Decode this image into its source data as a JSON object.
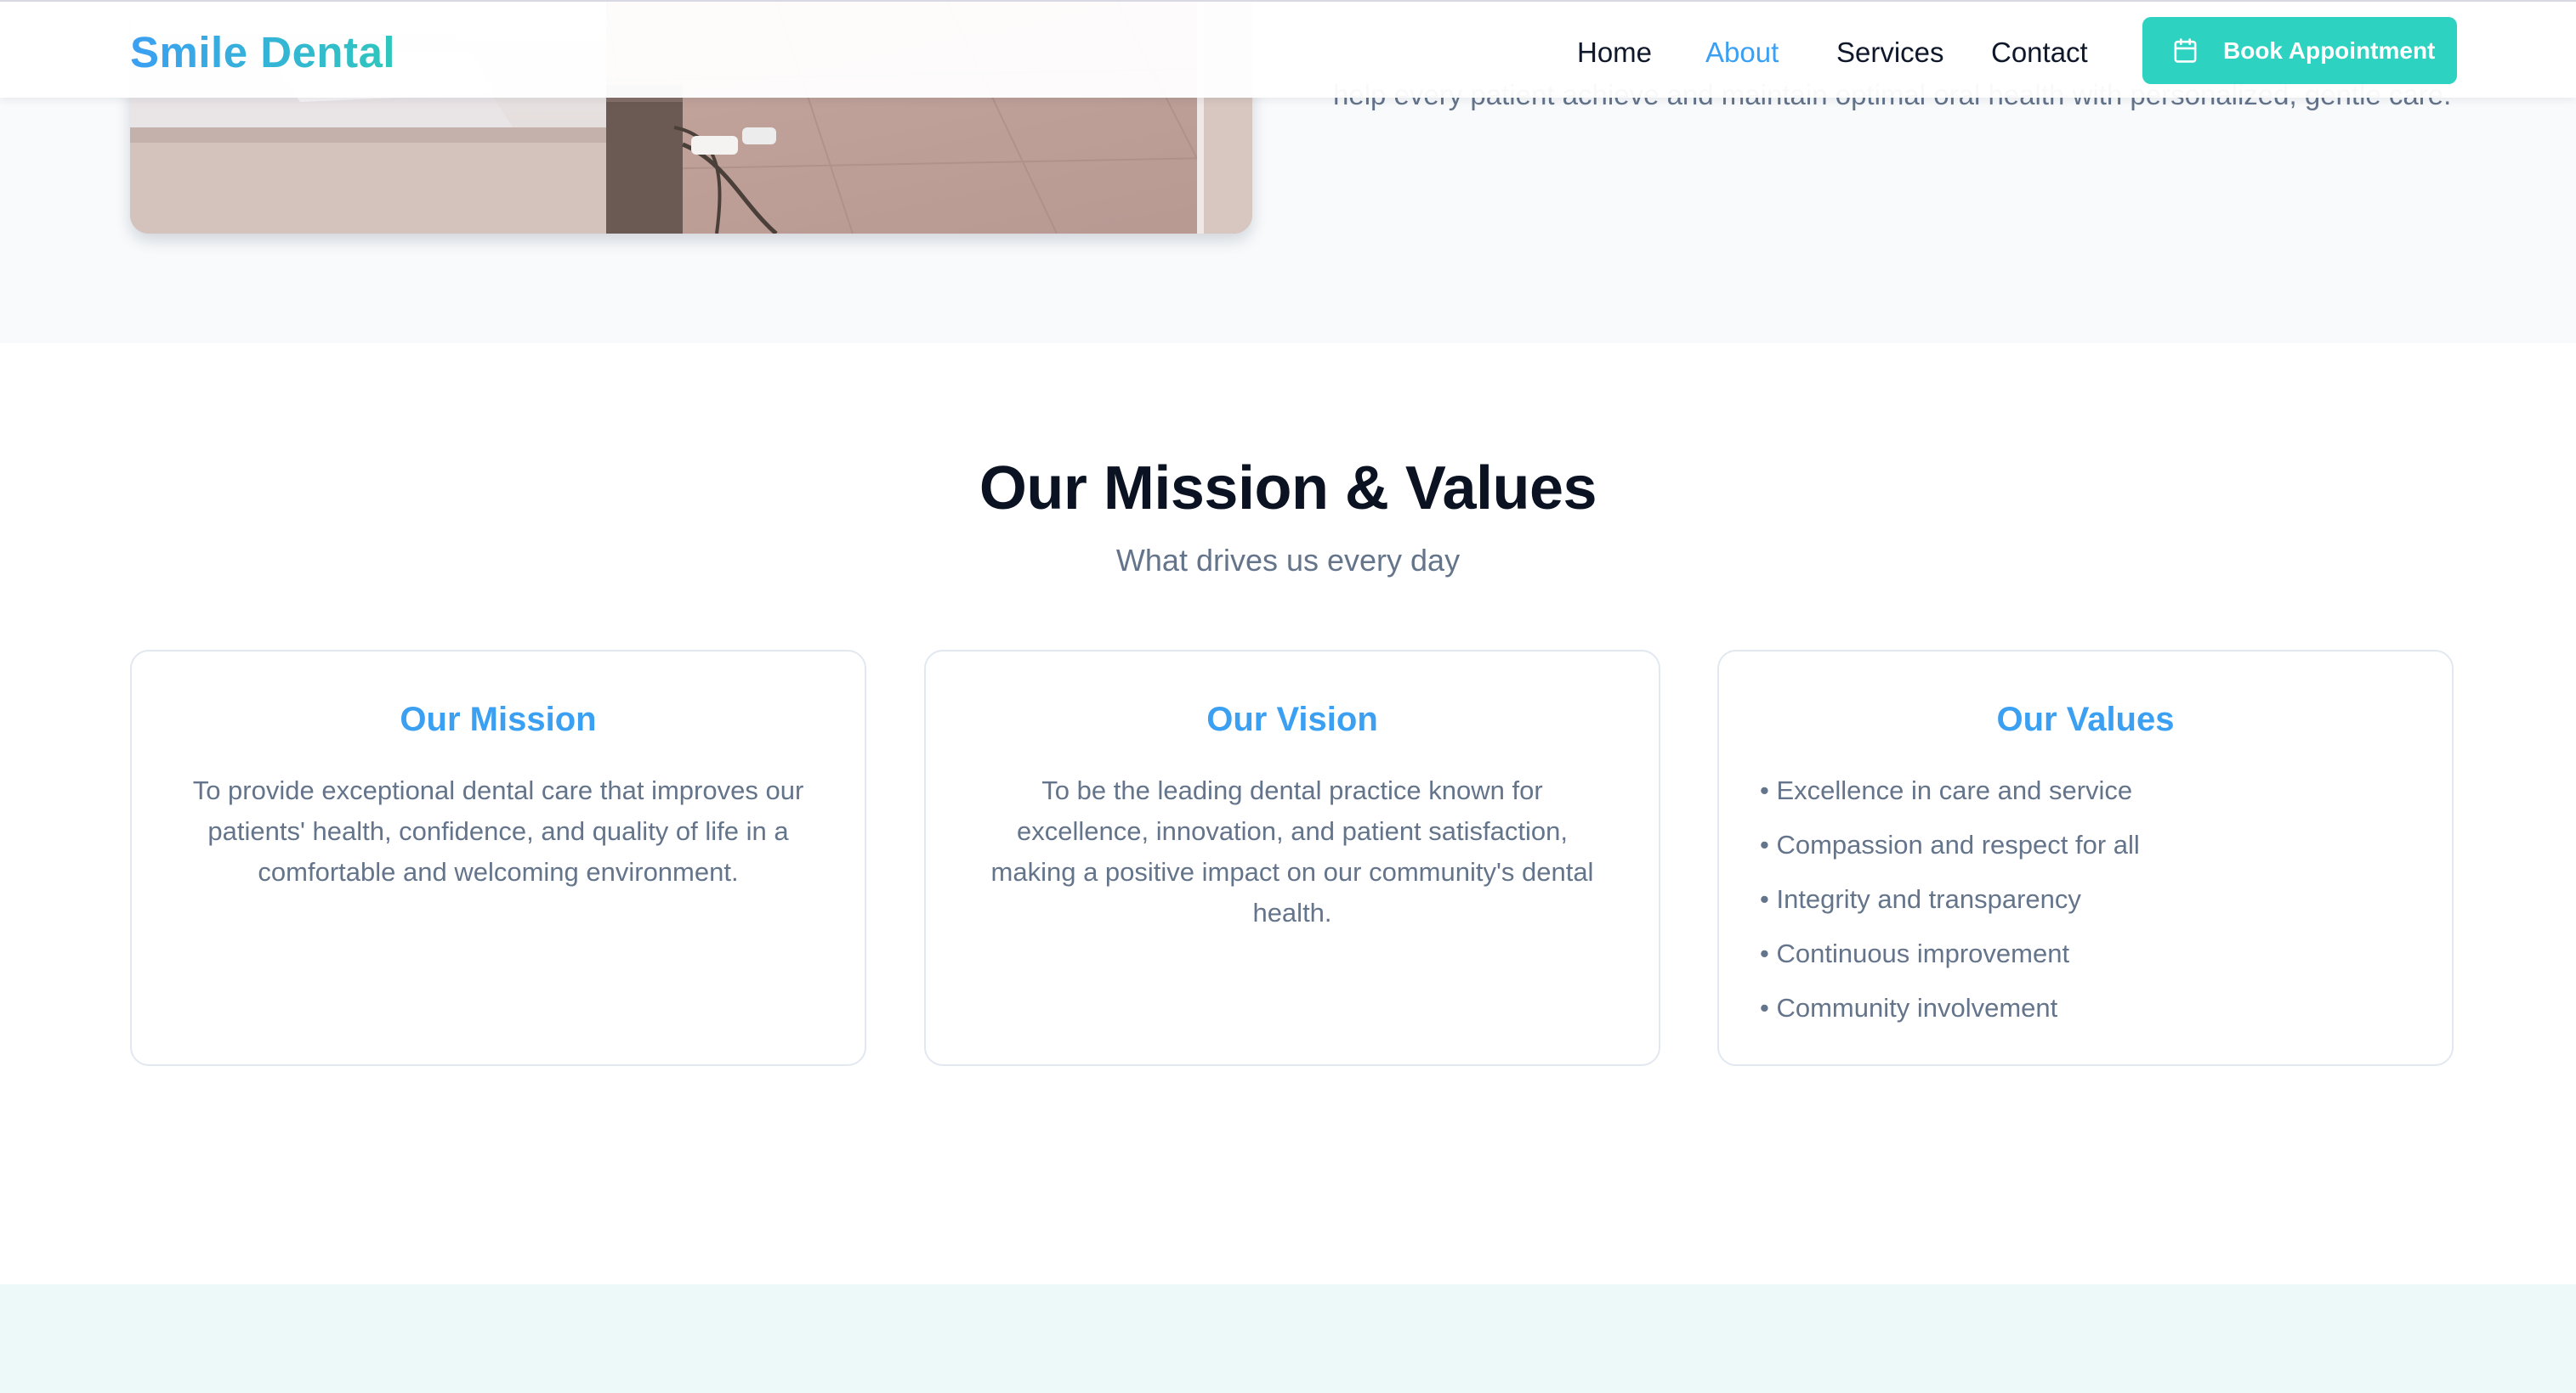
{
  "header": {
    "brand": "Smile Dental",
    "nav": {
      "home": "Home",
      "about": "About",
      "services": "Services",
      "contact": "Contact"
    },
    "active_nav": "About",
    "book_button": "Book Appointment",
    "book_icon": "calendar-icon"
  },
  "about": {
    "text_fragment": "help every patient achieve and maintain optimal oral health with personalized, gentle care."
  },
  "mission_section": {
    "title": "Our Mission & Values",
    "subtitle": "What drives us every day",
    "cards": {
      "mission": {
        "title": "Our Mission",
        "body": "To provide exceptional dental care that improves our patients' health, confidence, and quality of life in a comfortable and welcoming environment."
      },
      "vision": {
        "title": "Our Vision",
        "body": "To be the leading dental practice known for excellence, innovation, and patient satisfaction, making a positive impact on our community's dental health."
      },
      "values": {
        "title": "Our Values",
        "items": [
          "• Excellence in care and service",
          "• Compassion and respect for all",
          "• Integrity and transparency",
          "• Continuous improvement",
          "• Community involvement"
        ]
      }
    }
  },
  "colors": {
    "brand_blue": "#3b9ff2",
    "brand_teal": "#2dd2c1",
    "heading": "#0b1222",
    "muted": "#64748b"
  }
}
